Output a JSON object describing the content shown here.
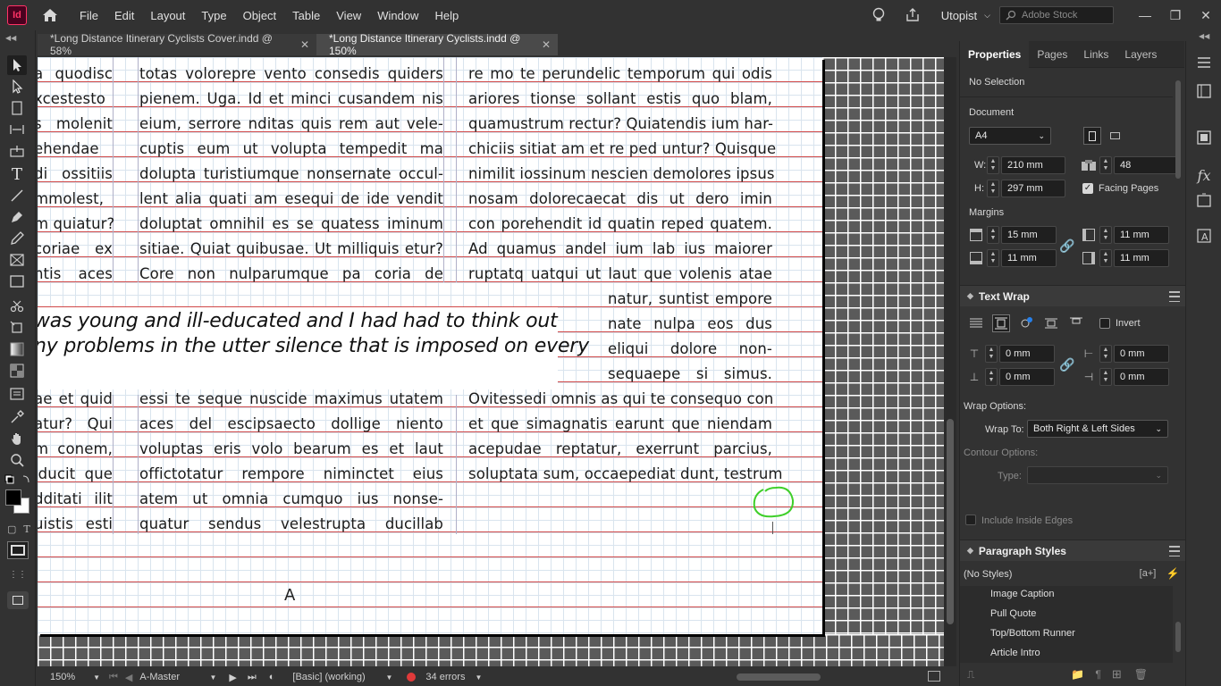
{
  "app": {
    "icon_text": "Id",
    "menu": [
      "File",
      "Edit",
      "Layout",
      "Type",
      "Object",
      "Table",
      "View",
      "Window",
      "Help"
    ],
    "workspace": "Utopist",
    "stock_search_placeholder": "Adobe Stock"
  },
  "tabs": [
    {
      "label": "*Long Distance Itinerary Cyclists Cover.indd @ 58%",
      "active": false
    },
    {
      "label": "*Long Distance Itinerary Cyclists.indd @ 150%",
      "active": true
    }
  ],
  "document": {
    "col1_top": [
      "a quodisc",
      "xcestesto",
      "s molenit",
      "ehendae",
      "di ossitiis",
      "mmolest,",
      "m quiatur?",
      "coriae ex",
      "ntis aces"
    ],
    "col2_top": [
      "totas volorepre vento consedis quiders",
      "pienem. Uga. Id et minci cusandem nis",
      "eium, serrore nditas quis rem aut vele-",
      "cuptis eum ut volupta tempedit ma",
      "dolupta turistiumque nonsernate occul-",
      "lent alia quati am esequi de ide vendit",
      "doluptat omnihil es se quatess iminum",
      "sitiae. Quiat quibusae. Ut milliquis etur?",
      "Core non nulparumque pa coria de"
    ],
    "col3_top": [
      "re mo te perundelic temporum qui odis",
      "ariores tionse sollant estis quo blam,",
      "quamustrum rectur? Quiatendis ium har-",
      "chiciis sitiat am et re ped untur? Quisque",
      "nimilit iossinum nescien demolores ipsus",
      "nosam dolorecaecat dis ut dero imin",
      "con porehendit id quatin reped quatem.",
      "Ad quamus andel ium lab ius maiorer",
      "ruptatq uatqui ut laut que volenis atae"
    ],
    "col3_wrap": [
      "natur, suntist empore",
      "nate nulpa eos dus",
      "eliqui dolore non-",
      "sequaepe si simus."
    ],
    "pull_quote": [
      "was young and ill-educated and I had had to think out",
      "ny problems in the utter silence that is imposed on every"
    ],
    "col1_bottom": [
      "ae et quid",
      "atur? Qui",
      "m conem,",
      "iducit que",
      "dditati ilit",
      "uistis esti"
    ],
    "col2_bottom": [
      "essi te seque nuscide maximus utatem",
      "aces del escipsaecto dollige niento",
      "voluptas eris volo bearum es et laut",
      "offictotatur rempore niminctet eius",
      "atem ut omnia cumquo ius nonse-",
      "quatur sendus velestrupta ducillab"
    ],
    "col3_bottom": [
      "Ovitessedi omnis as qui te consequo con",
      "et que simagnatis earunt que niendam",
      "acepudae reptatur, exerrunt parcius,",
      "soluptata sum, occaepediat dunt, testrum"
    ],
    "master_letter": "A"
  },
  "status": {
    "zoom": "150%",
    "page": "A-Master",
    "preflight_profile": "[Basic] (working)",
    "errors": "34 errors",
    "error_color": "#e03a3a"
  },
  "properties_panel": {
    "tabs": [
      "Properties",
      "Pages",
      "Links",
      "Layers"
    ],
    "selection": "No Selection",
    "document_label": "Document",
    "page_size": "A4",
    "width_label": "W:",
    "width": "210 mm",
    "height_label": "H:",
    "height": "297 mm",
    "pages": "48",
    "facing_pages": "Facing Pages",
    "facing_pages_checked": true,
    "margins_label": "Margins",
    "margin_top": "15 mm",
    "margin_bottom": "11 mm",
    "margin_inside": "11 mm",
    "margin_outside": "11 mm"
  },
  "text_wrap_panel": {
    "title": "Text Wrap",
    "invert": "Invert",
    "offset_top": "0 mm",
    "offset_bottom": "0 mm",
    "offset_left": "0 mm",
    "offset_right": "0 mm",
    "wrap_options": "Wrap Options:",
    "wrap_to_label": "Wrap To:",
    "wrap_to": "Both Right & Left Sides",
    "contour_options": "Contour Options:",
    "type_label": "Type:",
    "include_inside_edges": "Include Inside Edges"
  },
  "paragraph_styles_panel": {
    "title": "Paragraph Styles",
    "current": "(No Styles)",
    "styles": [
      "Image Caption",
      "Pull Quote",
      "Top/Bottom Runner",
      "Article Intro"
    ]
  },
  "colors": {
    "baseline": "#d04848",
    "annotation": "#3fcf2a",
    "accent": "#2680eb"
  }
}
